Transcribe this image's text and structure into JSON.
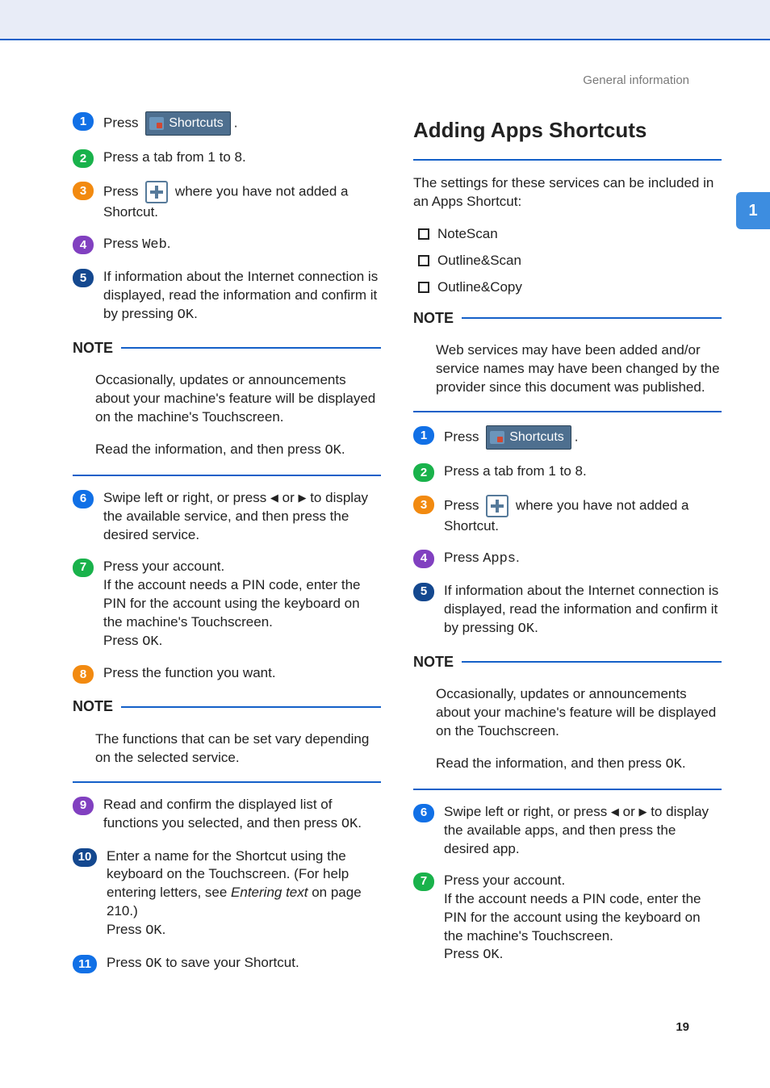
{
  "top_label": "General information",
  "side_tab_label": "1",
  "page_number": "19",
  "main": {
    "step1": {
      "pre": "Press "
    },
    "step2": "Press a tab from 1 to 8.",
    "step3": {
      "pre": "Press ",
      "post": " where you have not added a Shortcut."
    },
    "step4": {
      "pre": "Press ",
      "mono": "Web",
      "suffix": "."
    },
    "step5": {
      "text": "If information about the Internet connection is displayed, read the information and confirm it by pressing ",
      "mono": "OK",
      "suffix": "."
    },
    "note1_title": "NOTE",
    "note1_p1": "Occasionally, updates or announcements about your machine's feature will be displayed on the machine's Touchscreen.",
    "note1_p2": {
      "pre": "Read the information, and then press ",
      "mono": "OK",
      "suffix": "."
    },
    "step6": {
      "pre": "Swipe left or right, or press ",
      "mid": " or ",
      "post": " to display the available service, and then press the desired service."
    },
    "step7": {
      "l1": "Press your account.",
      "l2": "If the account needs a PIN code, enter the PIN for the account using the keyboard on the machine's Touchscreen.",
      "l3_pre": "Press ",
      "l3_mono": "OK",
      "l3_suffix": "."
    },
    "step8": "Press the function you want.",
    "note2_title": "NOTE",
    "note2_p": "The functions that can be set vary depending on the selected service.",
    "step9": {
      "pre": "Read and confirm the displayed list of functions you selected, and then press ",
      "mono": "OK",
      "suffix": "."
    },
    "step10": {
      "l1": "Enter a name for the Shortcut using the keyboard on the Touchscreen. (For help entering letters, see ",
      "italic": "Entering text",
      "l1b": " on page 210.)",
      "l2_pre": "Press ",
      "l2_mono": "OK",
      "l2_suffix": "."
    },
    "step11": {
      "pre": "Press ",
      "mono": "OK",
      "post": " to save your Shortcut."
    }
  },
  "right": {
    "title": "Adding Apps Shortcuts",
    "intro": "The settings for these services can be included in an Apps Shortcut:",
    "bullets": [
      "NoteScan",
      "Outline&Scan",
      "Outline&Copy"
    ],
    "noteA_title": "NOTE",
    "noteA_p": "Web services may have been added and/or service names may have been changed by the provider since this document was published.",
    "step1": {
      "pre": "Press "
    },
    "step2": "Press a tab from 1 to 8.",
    "step3": {
      "pre": "Press ",
      "post": " where you have not added a Shortcut."
    },
    "step4": {
      "pre": "Press ",
      "mono": "Apps",
      "suffix": "."
    },
    "step5": {
      "text": "If information about the Internet connection is displayed, read the information and confirm it by pressing ",
      "mono": "OK",
      "suffix": "."
    },
    "noteB_title": "NOTE",
    "noteB_p1": "Occasionally, updates or announcements about your machine's feature will be displayed on the Touchscreen.",
    "noteB_p2": {
      "pre": "Read the information, and then press ",
      "mono": "OK",
      "suffix": "."
    },
    "step6": {
      "pre": "Swipe left or right, or press ",
      "mid": " or ",
      "post": " to display the available apps, and then press the desired app."
    },
    "step7": {
      "l1": "Press your account.",
      "l2": "If the account needs a PIN code, enter the PIN for the account using the keyboard on the machine's Touchscreen.",
      "l3_pre": "Press ",
      "l3_mono": "OK",
      "l3_suffix": "."
    }
  },
  "icons": {
    "shortcuts_label": "Shortcuts"
  }
}
